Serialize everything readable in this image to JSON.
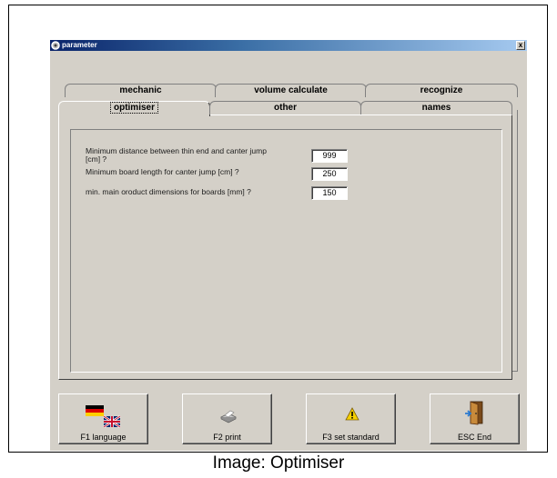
{
  "window": {
    "title": "parameter",
    "close_label": "x"
  },
  "tabs_back": [
    {
      "label": "mechanic"
    },
    {
      "label": "volume calculate"
    },
    {
      "label": "recognize"
    }
  ],
  "tabs_front": [
    {
      "label": "optimiser",
      "active": true
    },
    {
      "label": "other"
    },
    {
      "label": "names"
    }
  ],
  "fields": [
    {
      "label_line1": "Minimum distance between thin end and canter jump",
      "label_line2": "[cm] ?",
      "value": "999"
    },
    {
      "label": "Minimum board length for canter jump [cm] ?",
      "value": "250"
    },
    {
      "label": "min. main oroduct dimensions for boards [mm] ?",
      "value": "150"
    }
  ],
  "buttons": [
    {
      "label": "F1 language",
      "icon": "flags-icon"
    },
    {
      "label": "F2 print",
      "icon": "printer-icon"
    },
    {
      "label": "F3 set standard",
      "icon": "warning-icon"
    },
    {
      "label": "ESC End",
      "icon": "exit-door-icon"
    }
  ],
  "caption": "Image: Optimiser",
  "colors": {
    "face": "#d4d0c8",
    "titlebar": "#0a246a",
    "warning": "#f5d000"
  }
}
